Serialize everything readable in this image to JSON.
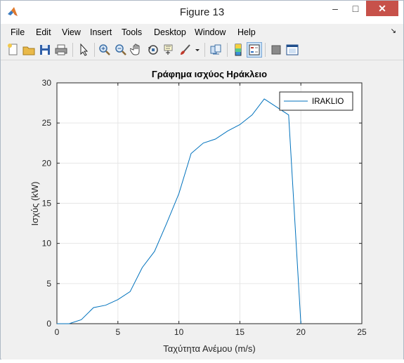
{
  "window": {
    "title": "Figure 13",
    "minimize_label": "–",
    "maximize_label": "□",
    "close_label": "✕"
  },
  "menu": {
    "items": [
      {
        "label": "File"
      },
      {
        "label": "Edit"
      },
      {
        "label": "View"
      },
      {
        "label": "Insert"
      },
      {
        "label": "Tools"
      },
      {
        "label": "Desktop"
      },
      {
        "label": "Window"
      },
      {
        "label": "Help"
      }
    ],
    "overflow_arrow": "↘"
  },
  "toolbar": {
    "icons": [
      "new-figure-icon",
      "open-file-icon",
      "save-icon",
      "print-icon",
      "pointer-icon",
      "zoom-in-icon",
      "zoom-out-icon",
      "pan-icon",
      "rotate-3d-icon",
      "data-cursor-icon",
      "brush-icon",
      "link-plot-icon",
      "colorbar-icon",
      "legend-icon",
      "hide-plot-tools-icon",
      "show-plot-tools-icon"
    ]
  },
  "chart_data": {
    "type": "line",
    "title": "Γράφημα ισχύος Ηράκλειο",
    "xlabel": "Ταχύτητα Ανέμου (m/s)",
    "ylabel": "Ισχύς (kW)",
    "xlim": [
      0,
      25
    ],
    "ylim": [
      0,
      30
    ],
    "xticks": [
      0,
      5,
      10,
      15,
      20,
      25
    ],
    "yticks": [
      0,
      5,
      10,
      15,
      20,
      25,
      30
    ],
    "grid": true,
    "legend_position": "top-right",
    "series": [
      {
        "name": "IRAKLIO",
        "color": "#0072bd",
        "x": [
          0,
          1,
          2,
          3,
          4,
          5,
          6,
          7,
          8,
          9,
          10,
          11,
          12,
          13,
          14,
          15,
          16,
          17,
          18,
          19,
          20
        ],
        "y": [
          0,
          0,
          0.5,
          2,
          2.3,
          3,
          4,
          7,
          9,
          12.5,
          16.2,
          21.2,
          22.5,
          23,
          24,
          24.8,
          26,
          28,
          27,
          26,
          0
        ]
      }
    ]
  }
}
